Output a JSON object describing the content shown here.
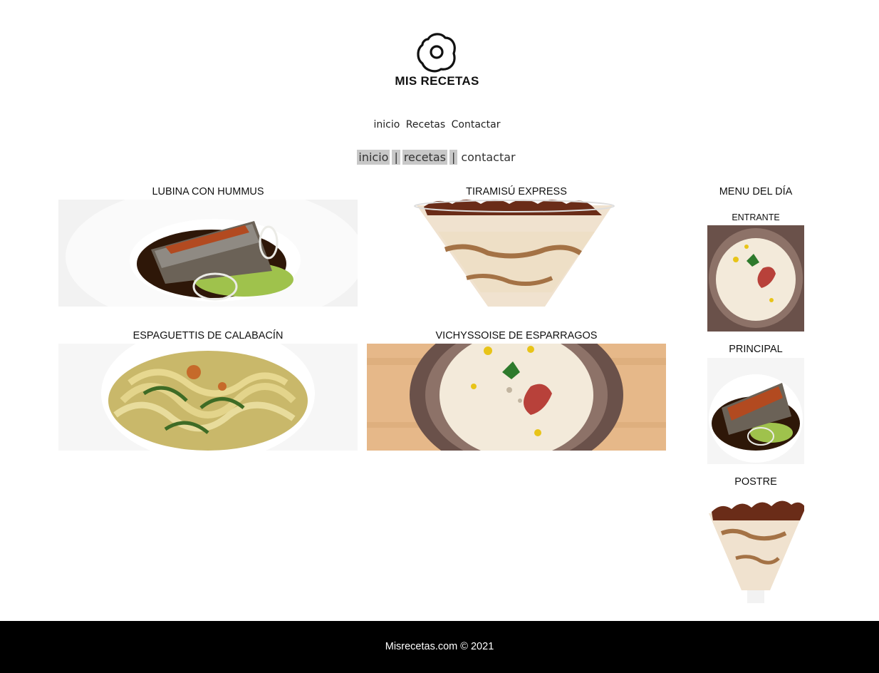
{
  "brand": {
    "name": "MIS RECETAS",
    "logo": "fried-egg-icon"
  },
  "nav_primary": [
    "inicio",
    "Recetas",
    "Contactar"
  ],
  "nav_secondary": {
    "items": [
      "inicio",
      "recetas",
      "contactar"
    ],
    "separator": "|"
  },
  "recipes": [
    {
      "title": "LUBINA CON HUMMUS",
      "image": "fish-with-hummus"
    },
    {
      "title": "TIRAMISÚ EXPRESS",
      "image": "tiramisu-glass"
    },
    {
      "title": "ESPAGUETTIS DE CALABACÍN",
      "image": "zucchini-spaghetti"
    },
    {
      "title": "VICHYSSOISE DE ESPARRAGOS",
      "image": "asparagus-vichyssoise"
    }
  ],
  "menu": {
    "title": "MENU DEL DÍA",
    "starter": "ENTRANTE",
    "main": "PRINCIPAL",
    "dessert": "POSTRE"
  },
  "footer": {
    "text": "Misrecetas.com © 2021"
  },
  "colors": {
    "footer_bg": "#000000",
    "nav_highlight": "#c8c8c8"
  }
}
